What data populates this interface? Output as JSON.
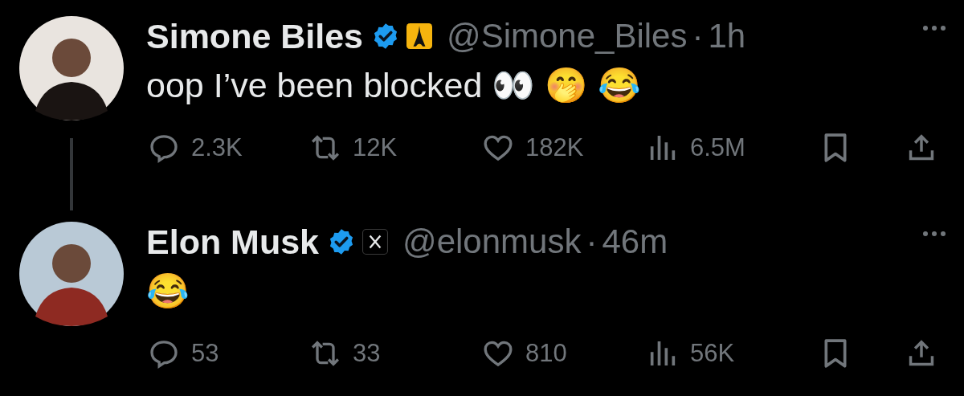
{
  "tweets": [
    {
      "author": {
        "name": "Simone Biles",
        "verified": true,
        "badge": {
          "kind": "tower"
        },
        "handle": "@Simone_Biles"
      },
      "separator": "·",
      "time": "1h",
      "text": "oop I’ve been blocked 👀 🤭 😂",
      "thread_line": true,
      "actions": [
        {
          "kind": "reply",
          "count": "2.3K"
        },
        {
          "kind": "repost",
          "count": "12K"
        },
        {
          "kind": "like",
          "count": "182K"
        },
        {
          "kind": "views",
          "count": "6.5M"
        },
        {
          "kind": "bookmark"
        },
        {
          "kind": "share"
        }
      ]
    },
    {
      "author": {
        "name": "Elon Musk",
        "verified": true,
        "badge": {
          "kind": "cross"
        },
        "handle": "@elonmusk"
      },
      "separator": "·",
      "time": "46m",
      "text": "😂",
      "thread_line": false,
      "actions": [
        {
          "kind": "reply",
          "count": "53"
        },
        {
          "kind": "repost",
          "count": "33"
        },
        {
          "kind": "like",
          "count": "810"
        },
        {
          "kind": "views",
          "count": "56K"
        },
        {
          "kind": "bookmark"
        },
        {
          "kind": "share"
        }
      ]
    }
  ]
}
